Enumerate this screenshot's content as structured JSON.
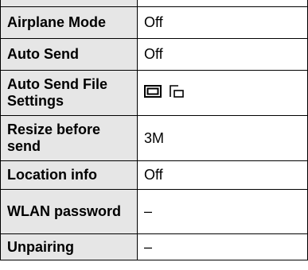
{
  "rows": [
    {
      "label": "Airplane Mode",
      "value": "Off"
    },
    {
      "label": "Auto Send",
      "value": "Off"
    },
    {
      "label": "Auto Send File Settings",
      "value": "",
      "icons": [
        "photo-frame-icon",
        "movie-frame-icon"
      ]
    },
    {
      "label": "Resize before send",
      "value": "3M"
    },
    {
      "label": "Location info",
      "value": "Off"
    },
    {
      "label": "WLAN password",
      "value": "–"
    },
    {
      "label": "Unpairing",
      "value": "–"
    }
  ]
}
